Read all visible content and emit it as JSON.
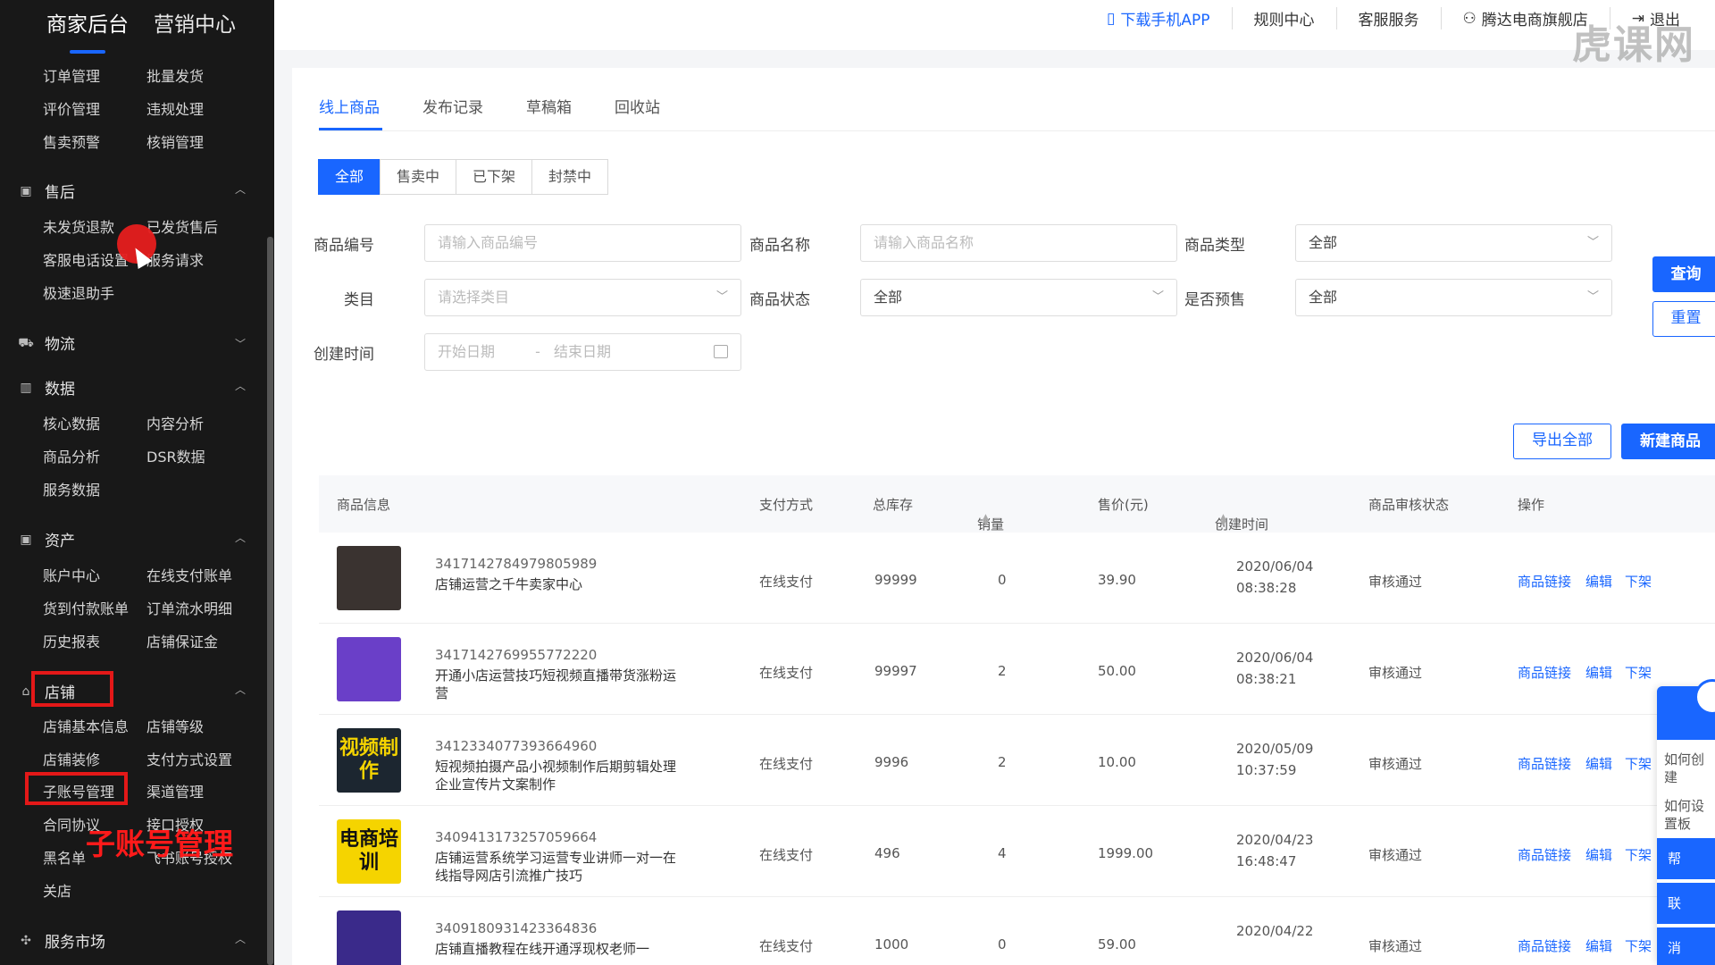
{
  "header": {
    "brand_tabs": [
      "商家后台",
      "营销中心"
    ],
    "links": [
      {
        "label": "下载手机APP",
        "icon": "phone-icon"
      },
      {
        "label": "规则中心"
      },
      {
        "label": "客服服务"
      },
      {
        "label": "腾达电商旗舰店",
        "icon": "user-icon"
      },
      {
        "label": "退出",
        "icon": "logout-icon"
      }
    ],
    "watermark": "虎课网"
  },
  "sidebar": {
    "top_items": [
      "订单管理",
      "批量发货",
      "评价管理",
      "违规处理",
      "售卖预警",
      "核销管理"
    ],
    "sections": [
      {
        "title": "售后",
        "items": [
          "未发货退款",
          "已发货售后",
          "客服电话设置",
          "服务请求",
          "极速退助手"
        ]
      },
      {
        "title": "物流",
        "items": []
      },
      {
        "title": "数据",
        "items": [
          "核心数据",
          "内容分析",
          "商品分析",
          "DSR数据",
          "服务数据"
        ]
      },
      {
        "title": "资产",
        "items": [
          "账户中心",
          "在线支付账单",
          "货到付款账单",
          "订单流水明细",
          "历史报表",
          "店铺保证金"
        ]
      },
      {
        "title": "店铺",
        "items": [
          "店铺基本信息",
          "店铺等级",
          "店铺装修",
          "支付方式设置",
          "子账号管理",
          "渠道管理",
          "合同协议",
          "接口授权",
          "黑名单",
          "飞书账号授权",
          "关店"
        ]
      },
      {
        "title": "服务市场",
        "items": []
      }
    ],
    "overlay_caption": "子账号管理"
  },
  "tabs": [
    "线上商品",
    "发布记录",
    "草稿箱",
    "回收站"
  ],
  "status_filters": [
    "全部",
    "售卖中",
    "已下架",
    "封禁中"
  ],
  "filters": {
    "product_id": {
      "label": "商品编号",
      "placeholder": "请输入商品编号"
    },
    "product_name": {
      "label": "商品名称",
      "placeholder": "请输入商品名称"
    },
    "product_type": {
      "label": "商品类型",
      "value": "全部"
    },
    "category": {
      "label": "类目",
      "placeholder": "请选择类目"
    },
    "product_status": {
      "label": "商品状态",
      "value": "全部"
    },
    "presale": {
      "label": "是否预售",
      "value": "全部"
    },
    "created": {
      "label": "创建时间",
      "start": "开始日期",
      "sep": "-",
      "end": "结束日期"
    }
  },
  "buttons": {
    "query": "查询",
    "reset": "重置",
    "export_all": "导出全部",
    "new_product": "新建商品"
  },
  "table": {
    "columns": [
      "商品信息",
      "支付方式",
      "总库存",
      "销量",
      "售价(元)",
      "创建时间",
      "商品审核状态",
      "操作"
    ],
    "rows": [
      {
        "id": "3417142784979805989",
        "name": "店铺运营之千牛卖家中心",
        "pay": "在线支付",
        "stock": "99999",
        "sales": "0",
        "price": "39.90",
        "date": "2020/06/04",
        "time": "08:38:28",
        "status": "审核通过",
        "thumb_text": "",
        "thumb_color": "#3a3330"
      },
      {
        "id": "3417142769955772220",
        "name": "开通小店运营技巧短视频直播带货涨粉运营",
        "pay": "在线支付",
        "stock": "99997",
        "sales": "2",
        "price": "50.00",
        "date": "2020/06/04",
        "time": "08:38:21",
        "status": "审核通过",
        "thumb_text": "",
        "thumb_color": "#6a3fc8"
      },
      {
        "id": "3412334077393664960",
        "name": "短视频拍摄产品小视频制作后期剪辑处理企业宣传片文案制作",
        "pay": "在线支付",
        "stock": "9996",
        "sales": "2",
        "price": "10.00",
        "date": "2020/05/09",
        "time": "10:37:59",
        "status": "审核通过",
        "thumb_text": "视频制作",
        "thumb_color": "#1c2630"
      },
      {
        "id": "3409413173257059664",
        "name": "店铺运营系统学习运营专业讲师一对一在线指导网店引流推广技巧",
        "pay": "在线支付",
        "stock": "496",
        "sales": "4",
        "price": "1999.00",
        "date": "2020/04/23",
        "time": "16:48:47",
        "status": "审核通过",
        "thumb_text": "电商培训",
        "thumb_color": "#f5d400"
      },
      {
        "id": "3409180931423364836",
        "name": "店铺直播教程在线开通浮现权老师一",
        "pay": "在线支付",
        "stock": "1000",
        "sales": "0",
        "price": "59.00",
        "date": "2020/04/22",
        "time": "",
        "status": "审核通过",
        "thumb_text": "",
        "thumb_color": "#3a2a8a"
      }
    ],
    "actions": [
      "商品链接",
      "编辑",
      "下架"
    ]
  },
  "help_widget": {
    "questions": [
      "如何创建",
      "如何设置板"
    ],
    "buttons": [
      "帮",
      "联",
      "消"
    ]
  },
  "colors": {
    "accent": "#1966ff",
    "sidebar_bg": "#181818",
    "highlight": "#e41818"
  }
}
